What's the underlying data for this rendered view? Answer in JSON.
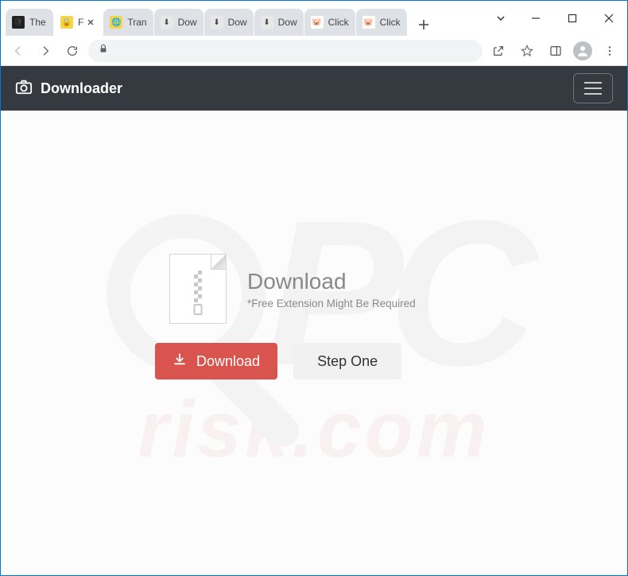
{
  "window": {
    "tabs": [
      {
        "title": "The",
        "favicon_bg": "#222",
        "favicon_glyph": "🛡"
      },
      {
        "title": "F",
        "favicon_bg": "#f7d54a",
        "favicon_glyph": "🔒",
        "active": true
      },
      {
        "title": "Tran",
        "favicon_bg": "#f7d54a",
        "favicon_glyph": "🌐"
      },
      {
        "title": "Dow",
        "favicon_bg": "#e8e8e8",
        "favicon_glyph": "⬇"
      },
      {
        "title": "Dow",
        "favicon_bg": "#e8e8e8",
        "favicon_glyph": "⬇"
      },
      {
        "title": "Dow",
        "favicon_bg": "#e8e8e8",
        "favicon_glyph": "⬇"
      },
      {
        "title": "Click",
        "favicon_bg": "#fff",
        "favicon_glyph": "🐷"
      },
      {
        "title": "Click",
        "favicon_bg": "#fff",
        "favicon_glyph": "🐷"
      }
    ]
  },
  "header": {
    "brand": "Downloader"
  },
  "card": {
    "heading": "Download",
    "subtext": "*Free Extension Might Be Required",
    "download_button": "Download",
    "step_button": "Step One"
  },
  "watermark": {
    "top": "PC",
    "bottom": "risk.com"
  }
}
